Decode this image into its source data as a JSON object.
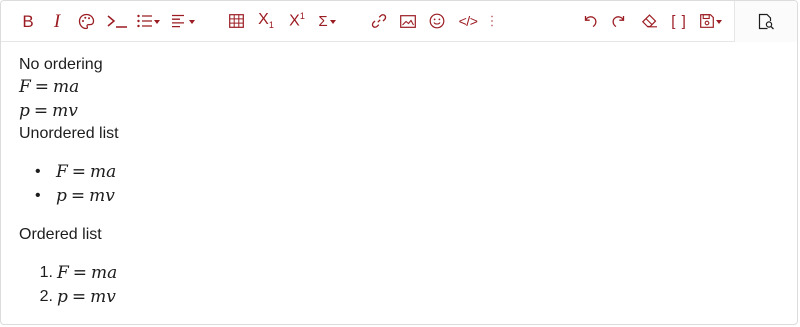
{
  "toolbar": {
    "left_buttons": [
      {
        "name": "bold-button",
        "icon": "bold-icon",
        "glyph": "B"
      },
      {
        "name": "italic-button",
        "icon": "italic-icon",
        "glyph": "I"
      },
      {
        "name": "color-button",
        "icon": "palette-icon"
      },
      {
        "name": "code-block-button",
        "icon": "terminal-icon",
        "glyph": "›_"
      },
      {
        "name": "bullet-list-button",
        "icon": "list-icon"
      },
      {
        "name": "align-button",
        "icon": "align-left-icon"
      },
      {
        "name": "table-button",
        "icon": "table-icon"
      },
      {
        "name": "subscript-button",
        "icon": "subscript-icon",
        "glyph": "X",
        "sub": "1"
      },
      {
        "name": "superscript-button",
        "icon": "superscript-icon",
        "glyph": "X",
        "sup": "1"
      },
      {
        "name": "formula-button",
        "icon": "sigma-icon",
        "glyph": "Σ"
      },
      {
        "name": "link-button",
        "icon": "link-icon"
      },
      {
        "name": "image-button",
        "icon": "image-icon"
      },
      {
        "name": "emoji-button",
        "icon": "smiley-icon"
      },
      {
        "name": "html-button",
        "icon": "code-icon",
        "glyph": "</>"
      },
      {
        "name": "more-button",
        "icon": "more-vertical-icon"
      }
    ],
    "right_buttons": [
      {
        "name": "undo-button",
        "icon": "undo-icon"
      },
      {
        "name": "redo-button",
        "icon": "redo-icon"
      },
      {
        "name": "clear-format-button",
        "icon": "eraser-icon"
      },
      {
        "name": "fullscreen-button",
        "icon": "brackets-icon",
        "glyph": "[ ]"
      },
      {
        "name": "save-button",
        "icon": "save-icon"
      },
      {
        "name": "preview-button",
        "icon": "preview-icon"
      }
    ],
    "accent_color": "#9b1c22"
  },
  "content": {
    "no_ordering_label": "No ordering",
    "unordered_label": "Unordered list",
    "ordered_label": "Ordered list",
    "formula1": {
      "lhs": "F",
      "op": "=",
      "rhs": "ma"
    },
    "formula2": {
      "lhs": "p",
      "op": "=",
      "rhs": "mv"
    },
    "unordered_marker": "•",
    "ordered_markers": [
      "1.",
      "2."
    ]
  }
}
